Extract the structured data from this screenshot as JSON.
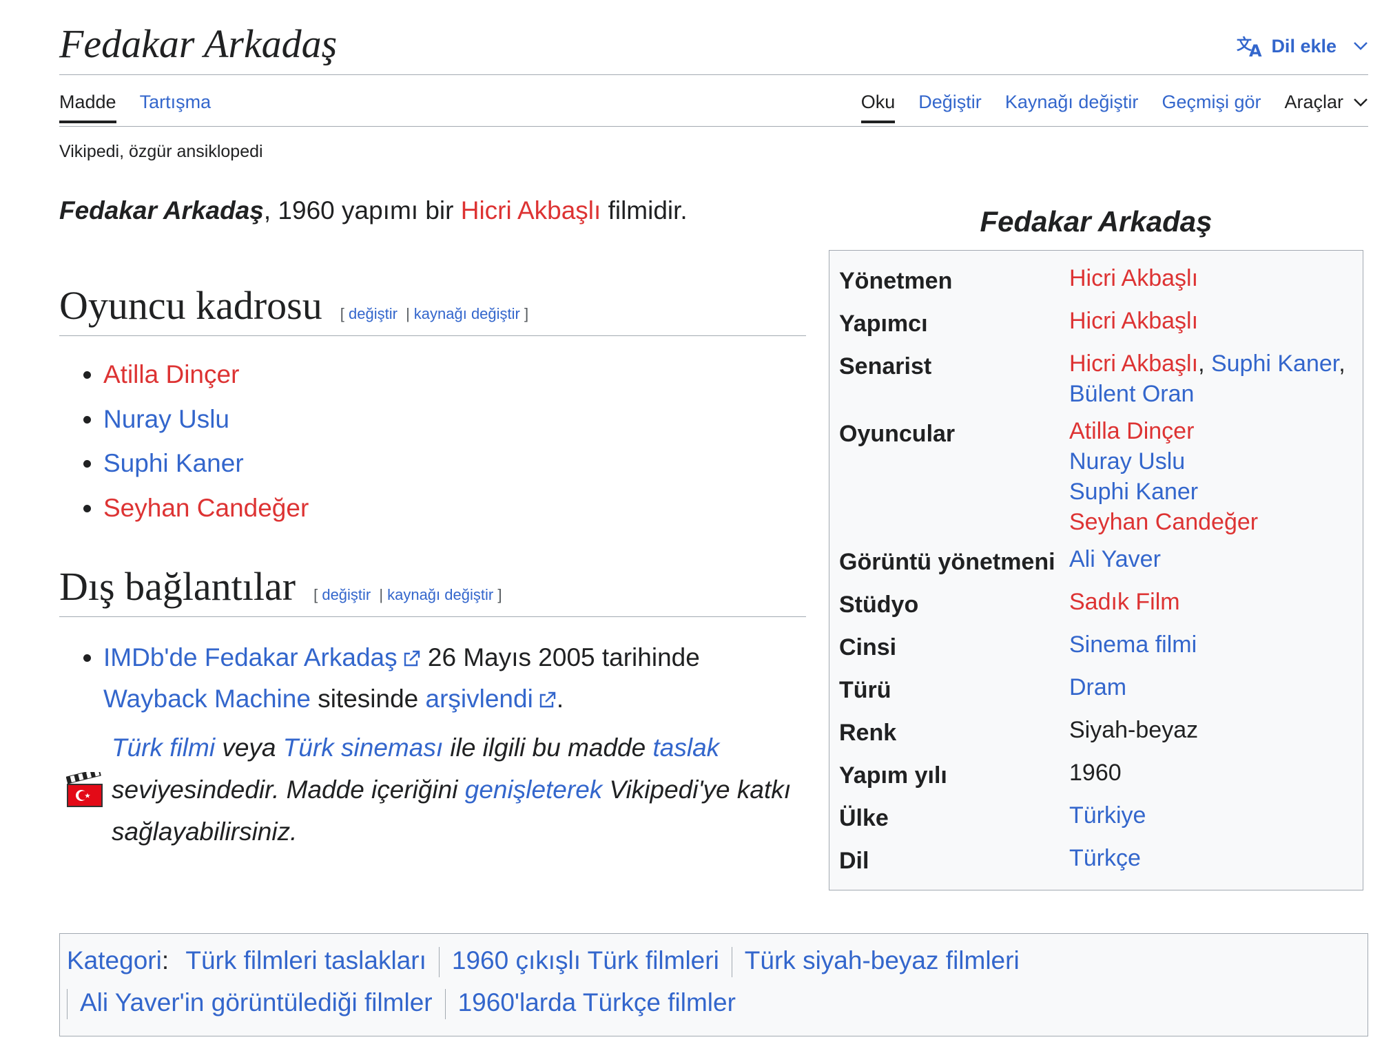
{
  "page": {
    "title": "Fedakar Arkadaş",
    "add_language": "Dil ekle",
    "tagline": "Vikipedi, özgür ansiklopedi"
  },
  "tabs": {
    "article": "Madde",
    "talk": "Tartışma",
    "read": "Oku",
    "edit": "Değiştir",
    "edit_source": "Kaynağı değiştir",
    "history": "Geçmişi gör",
    "tools": "Araçlar"
  },
  "intro": {
    "bold_title": "Fedakar Arkadaş",
    "text_before": ", 1960 yapımı bir ",
    "director": "Hicri Akbaşlı",
    "text_after": " filmidir."
  },
  "sections": {
    "cast_heading": "Oyuncu kadrosu",
    "external_heading": "Dış bağlantılar",
    "edit_link": "değiştir",
    "edit_source_link": "kaynağı değiştir",
    "bracket_open": "[",
    "bracket_close": "]",
    "separator": "|"
  },
  "cast": [
    {
      "name": "Atilla Dinçer",
      "exists": false
    },
    {
      "name": "Nuray Uslu",
      "exists": true
    },
    {
      "name": "Suphi Kaner",
      "exists": true
    },
    {
      "name": "Seyhan Candeğer",
      "exists": false
    }
  ],
  "external": {
    "imdb_link": "IMDb'de Fedakar Arkadaş",
    "archived_text": " 26 Mayıs 2005 tarihinde",
    "wayback_link": "Wayback Machine",
    "site_text": " sitesinde ",
    "archived_link": "arşivlendi",
    "period": "."
  },
  "stub": {
    "link1": "Türk filmi",
    "t1": " veya ",
    "link2": "Türk sineması",
    "t2": " ile ilgili bu madde ",
    "link3": "taslak",
    "t3": " seviyesindedir. Madde içeriğini ",
    "link4": "genişleterek",
    "t4": " Vikipedi'ye katkı sağlayabilirsiniz."
  },
  "infobox": {
    "caption": "Fedakar Arkadaş",
    "director_label": "Yönetmen",
    "director": "Hicri Akbaşlı",
    "producer_label": "Yapımcı",
    "producer": "Hicri Akbaşlı",
    "writer_label": "Senarist",
    "writer_1": "Hicri Akbaşlı",
    "writer_2": "Suphi Kaner",
    "writer_3": "Bülent Oran",
    "comma": ",",
    "cast_label": "Oyuncular",
    "cast_1": "Atilla Dinçer",
    "cast_2": "Nuray Uslu",
    "cast_3": "Suphi Kaner",
    "cast_4": "Seyhan Candeğer",
    "cinematographer_label": "Görüntü yönetmeni",
    "cinematographer": "Ali Yaver",
    "studio_label": "Stüdyo",
    "studio": "Sadık Film",
    "type_label": "Cinsi",
    "type": "Sinema filmi",
    "genre_label": "Türü",
    "genre": "Dram",
    "color_label": "Renk",
    "color": "Siyah-beyaz",
    "year_label": "Yapım yılı",
    "year": "1960",
    "country_label": "Ülke",
    "country": "Türkiye",
    "language_label": "Dil",
    "language": "Türkçe"
  },
  "categories": {
    "label": "Kategori",
    "colon": ":",
    "items": [
      "Türk filmleri taslakları",
      "1960 çıkışlı Türk filmleri",
      "Türk siyah-beyaz filmleri",
      "Ali Yaver'in görüntülediği filmler",
      "1960'larda Türkçe filmler"
    ]
  },
  "colors": {
    "link": "#3366cc",
    "red_link": "#dd3333",
    "text": "#202122",
    "border": "#a2a9b1",
    "box_bg": "#f8f9fa"
  },
  "icons": [
    "translate-icon",
    "chevron-down-icon",
    "external-link-icon",
    "film-clapper-icon"
  ]
}
